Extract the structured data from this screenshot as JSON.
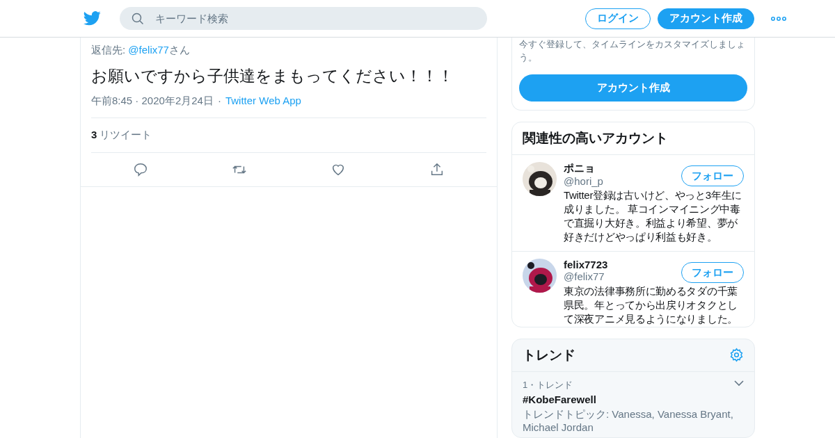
{
  "header": {
    "search_placeholder": "キーワード検索",
    "buttons": [
      {
        "label": "ログイン",
        "kind": "outline"
      },
      {
        "label": "アカウント作成",
        "kind": "filled"
      }
    ]
  },
  "tweet": {
    "reply_prefix": "返信先: ",
    "reply_handle": "@felix77",
    "reply_suffix": "さん",
    "text": "お願いですから子供達をまもってください！！！",
    "time": "午前8:45 · 2020年2月24日",
    "separator": "·",
    "source": "Twitter Web App",
    "retweet_count": "3",
    "retweet_label": "リツイート"
  },
  "signup": {
    "text": "今すぐ登録して、タイムラインをカスタマイズしましょう。",
    "button": "アカウント作成"
  },
  "related": {
    "title": "関連性の高いアカウント",
    "accounts": [
      {
        "name": "ポニョ",
        "handle": "@hori_p",
        "bio": "Twitter登録は古いけど、やっと3年生に成りました。 草コインマイニング中毒で直掘り大好き。利益より希望、夢が好きだけどやっぱり利益も好き。",
        "follow": "フォロー"
      },
      {
        "name": "felix7723",
        "handle": "@felix77",
        "bio": "東京の法律事務所に勤めるタダの千葉県民。年とってから出戻りオタクとして深夜アニメ見るようになりました。",
        "follow": "フォロー"
      }
    ]
  },
  "trends": {
    "title": "トレンド",
    "items": [
      {
        "meta": "1・トレンド",
        "name": "#KobeFarewell",
        "topics": "トレンドトピック: Vanessa, Vanessa Bryant, Michael Jordan"
      }
    ]
  }
}
